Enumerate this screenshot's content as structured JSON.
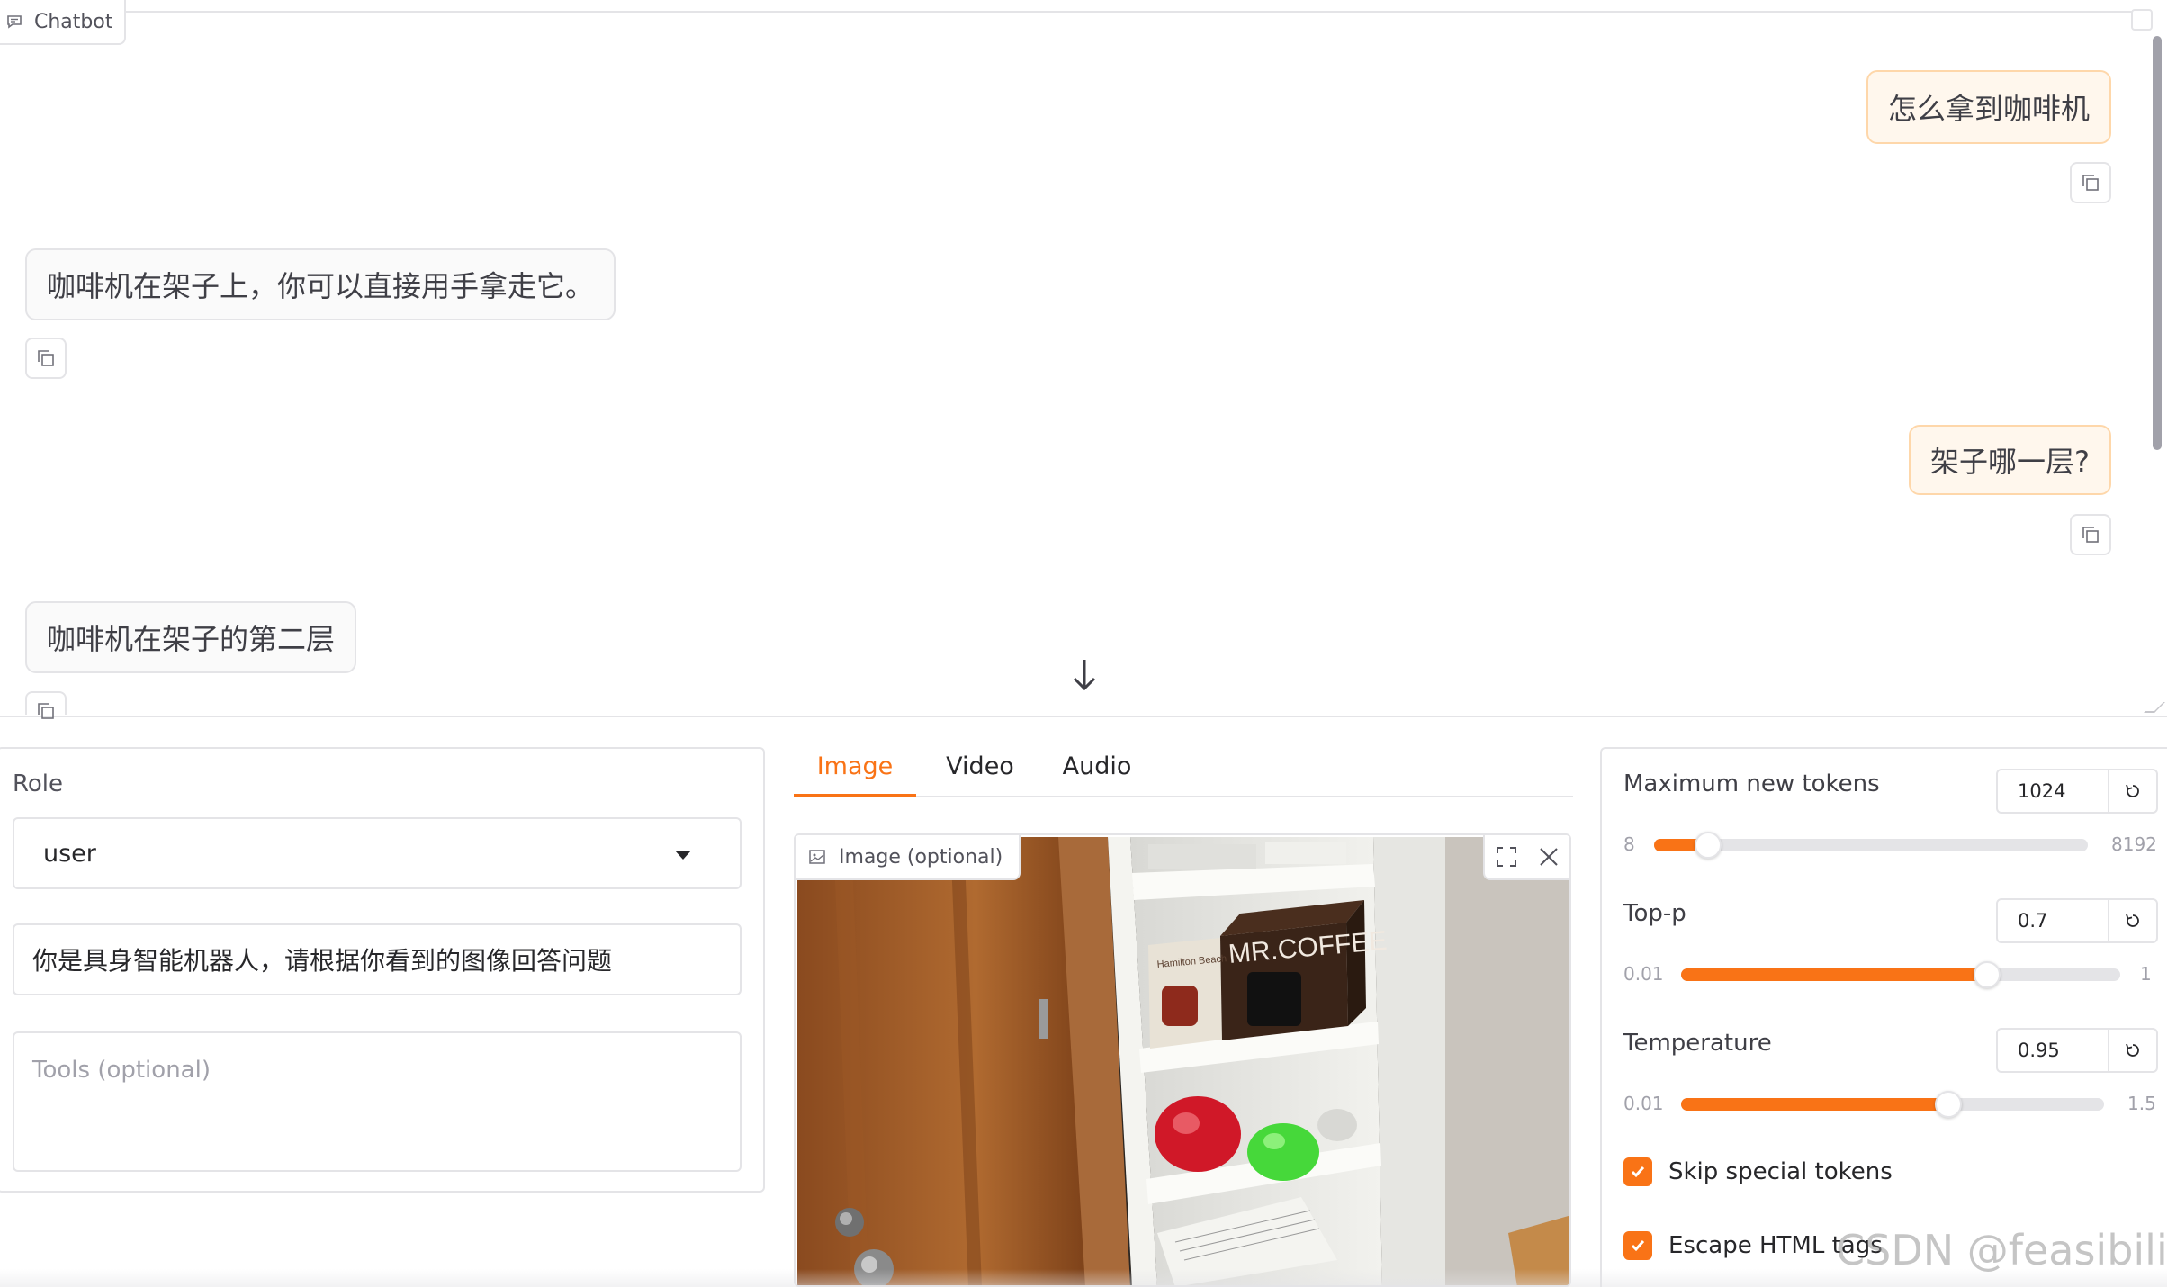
{
  "chatbot": {
    "label": "Chatbot",
    "messages": [
      {
        "role": "user",
        "text": "怎么拿到咖啡机"
      },
      {
        "role": "assistant",
        "text": "咖啡机在架子上，你可以直接用手拿走它。"
      },
      {
        "role": "user",
        "text": "架子哪一层?"
      },
      {
        "role": "assistant",
        "text": "咖啡机在架子的第二层"
      }
    ]
  },
  "left": {
    "role_label": "Role",
    "role_value": "user",
    "system_prompt": "你是具身智能机器人，请根据你看到的图像回答问题",
    "tools_placeholder": "Tools (optional)"
  },
  "media": {
    "tabs": [
      "Image",
      "Video",
      "Audio"
    ],
    "active_tab": "Image",
    "image_label": "Image (optional)",
    "image_text": {
      "brand1": "MR.COFFEE",
      "brand2": "Hamilton Beach"
    }
  },
  "params": {
    "max_tokens": {
      "label": "Maximum new tokens",
      "value": "1024",
      "min": "8",
      "max": "8192",
      "fraction": 0.124
    },
    "top_p": {
      "label": "Top-p",
      "value": "0.7",
      "min": "0.01",
      "max": "1",
      "fraction": 0.697
    },
    "temperature": {
      "label": "Temperature",
      "value": "0.95",
      "min": "0.01",
      "max": "1.5",
      "fraction": 0.631
    },
    "checkboxes": [
      {
        "label": "Skip special tokens",
        "checked": true
      },
      {
        "label": "Escape HTML tags",
        "checked": true
      }
    ]
  },
  "watermark": "CSDN @feasibility.",
  "colors": {
    "accent": "#f97316",
    "user_bubble": "#fff7ed",
    "border": "#e4e4e7"
  }
}
